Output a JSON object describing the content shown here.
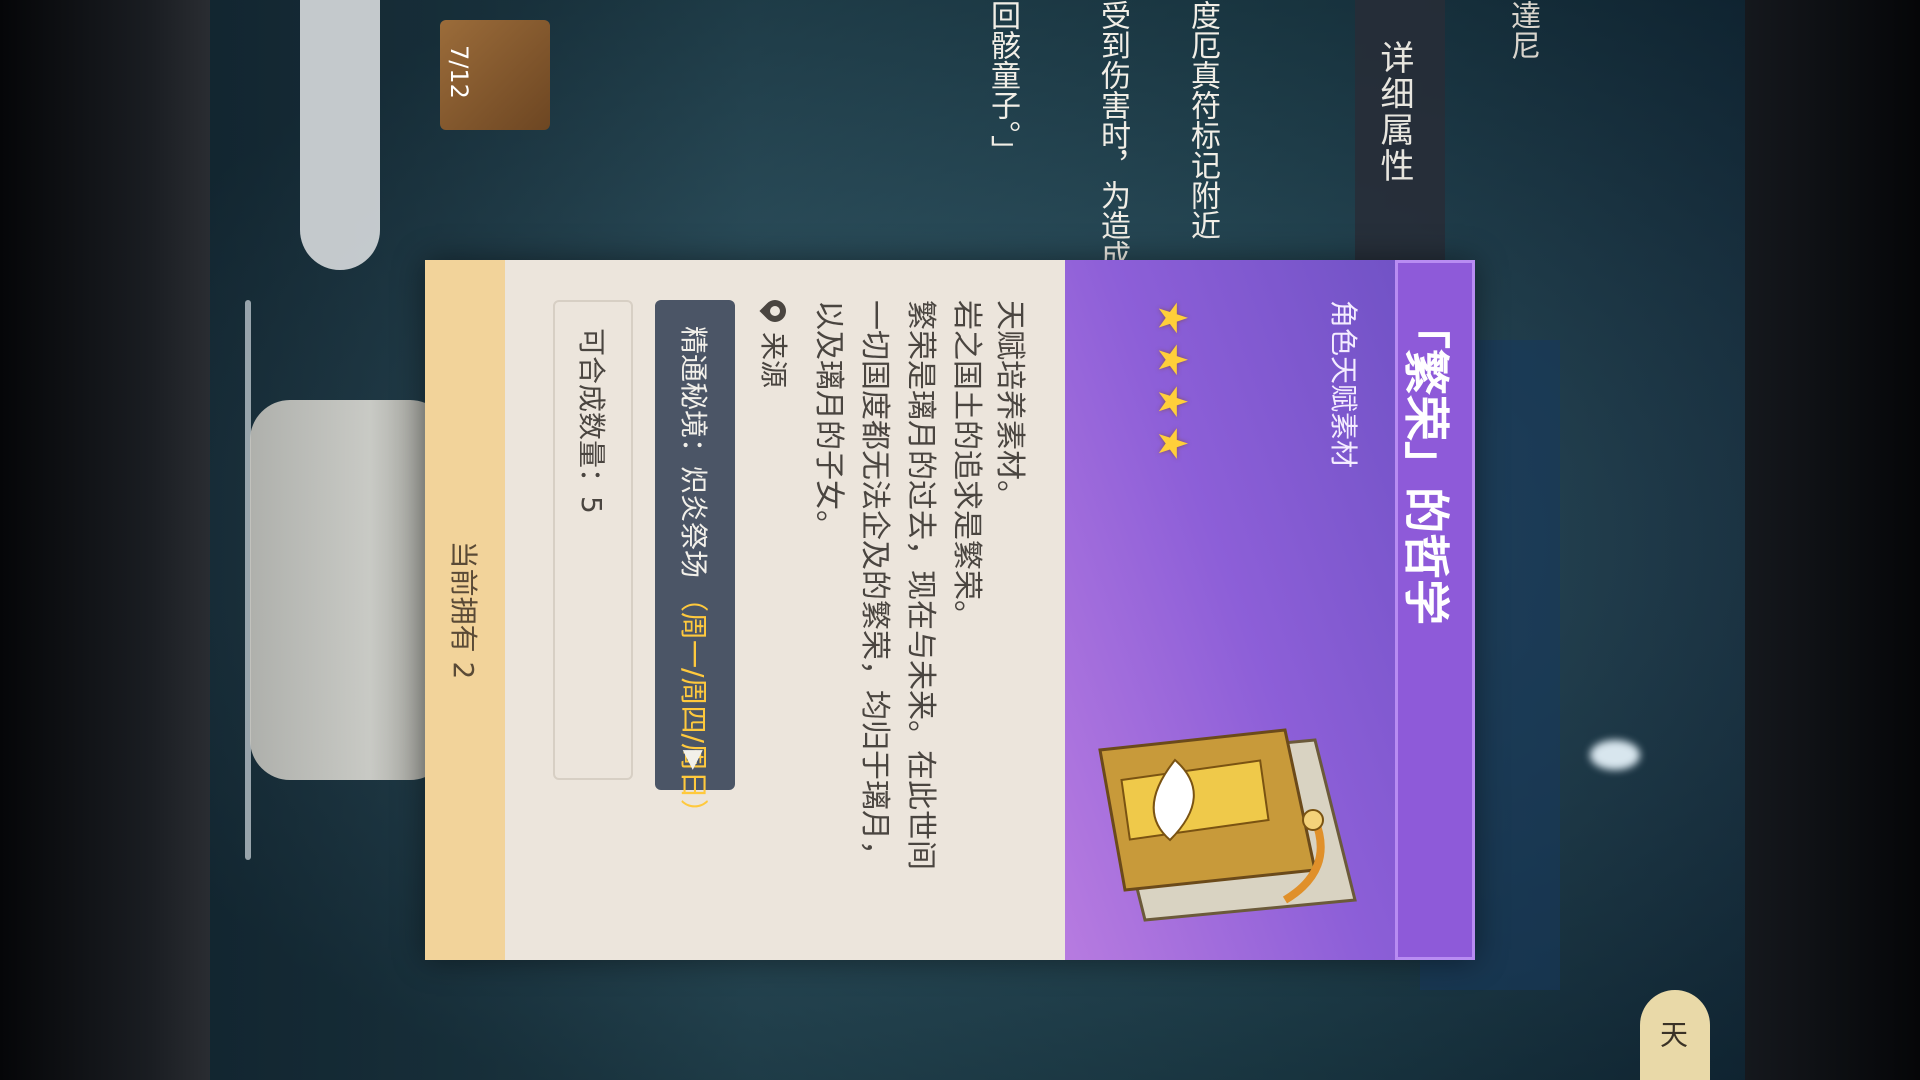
{
  "background": {
    "detail_tab_label": "详细属性",
    "top_text": "達尼",
    "desc_line_1": "度厄真符标记附近",
    "desc_line_2": "受到伤害时，为造成",
    "desc_line_3": "回骸童子。」",
    "item_count": "7/12",
    "bottom_button_label": "天"
  },
  "card": {
    "title": "「繁荣」的哲学",
    "subtitle": "角色天赋素材",
    "stars": "★★★★",
    "rarity": 4,
    "description_type": "天赋培养素材。",
    "description_lines": [
      "岩之国土的追求是繁荣。",
      "繁荣是璃月的过去，现在与未来。在此世间",
      "一切国度都无法企及的繁荣，均归于璃月，",
      "以及璃月的子女。"
    ],
    "source_label": "来源",
    "domain_name": "精通秘境：炽炎祭场",
    "domain_days": "（周一/周四/周日）",
    "craftable_label": "可合成数量：5",
    "owned_label": "当前拥有 2"
  },
  "colors": {
    "header_purple": "#8e5ad9",
    "star_gold": "#ffcf3a",
    "domain_days_gold": "#ffc93d",
    "footer_cream": "#f2d39a"
  }
}
